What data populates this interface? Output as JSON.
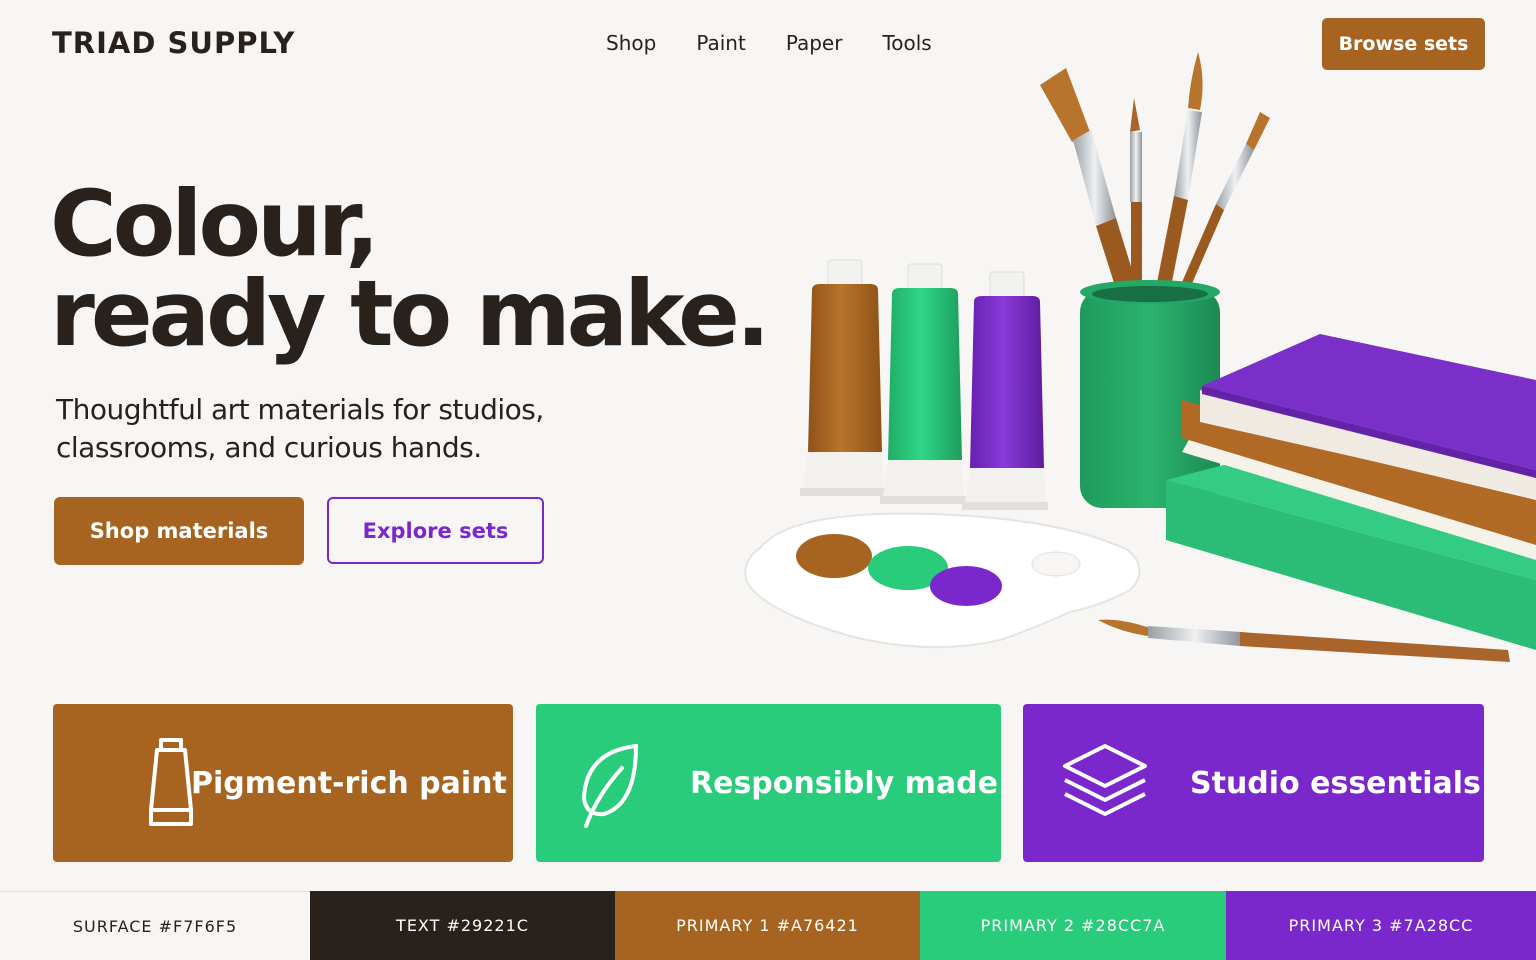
{
  "brand": {
    "name": "TRIAD SUPPLY"
  },
  "nav": {
    "items": [
      "Shop",
      "Paint",
      "Paper",
      "Tools"
    ]
  },
  "header": {
    "cta_label": "Browse sets"
  },
  "hero": {
    "headline_line1": "Colour,",
    "headline_line2": "ready to make.",
    "subtitle": "Thoughtful art materials for studios, classrooms, and curious hands.",
    "primary_cta": "Shop materials",
    "secondary_cta": "Explore sets"
  },
  "features": [
    {
      "title": "Pigment-rich paint",
      "icon": "paint-tube-icon",
      "color": "#A76421"
    },
    {
      "title": "Responsibly made",
      "icon": "leaf-icon",
      "color": "#28CC7A"
    },
    {
      "title": "Studio essentials",
      "icon": "layers-icon",
      "color": "#7A28CC"
    }
  ],
  "palette": [
    {
      "label": "SURFACE #F7F6F5",
      "color": "#F7F6F5",
      "text_color": "#29221C"
    },
    {
      "label": "TEXT #29221C",
      "color": "#29221C",
      "text_color": "#FFFFFF"
    },
    {
      "label": "PRIMARY 1 #A76421",
      "color": "#A76421",
      "text_color": "#FFFFFF"
    },
    {
      "label": "PRIMARY 2 #28CC7A",
      "color": "#28CC7A",
      "text_color": "#FFFFFF"
    },
    {
      "label": "PRIMARY 3 #7A28CC",
      "color": "#7A28CC",
      "text_color": "#FFFFFF"
    }
  ]
}
